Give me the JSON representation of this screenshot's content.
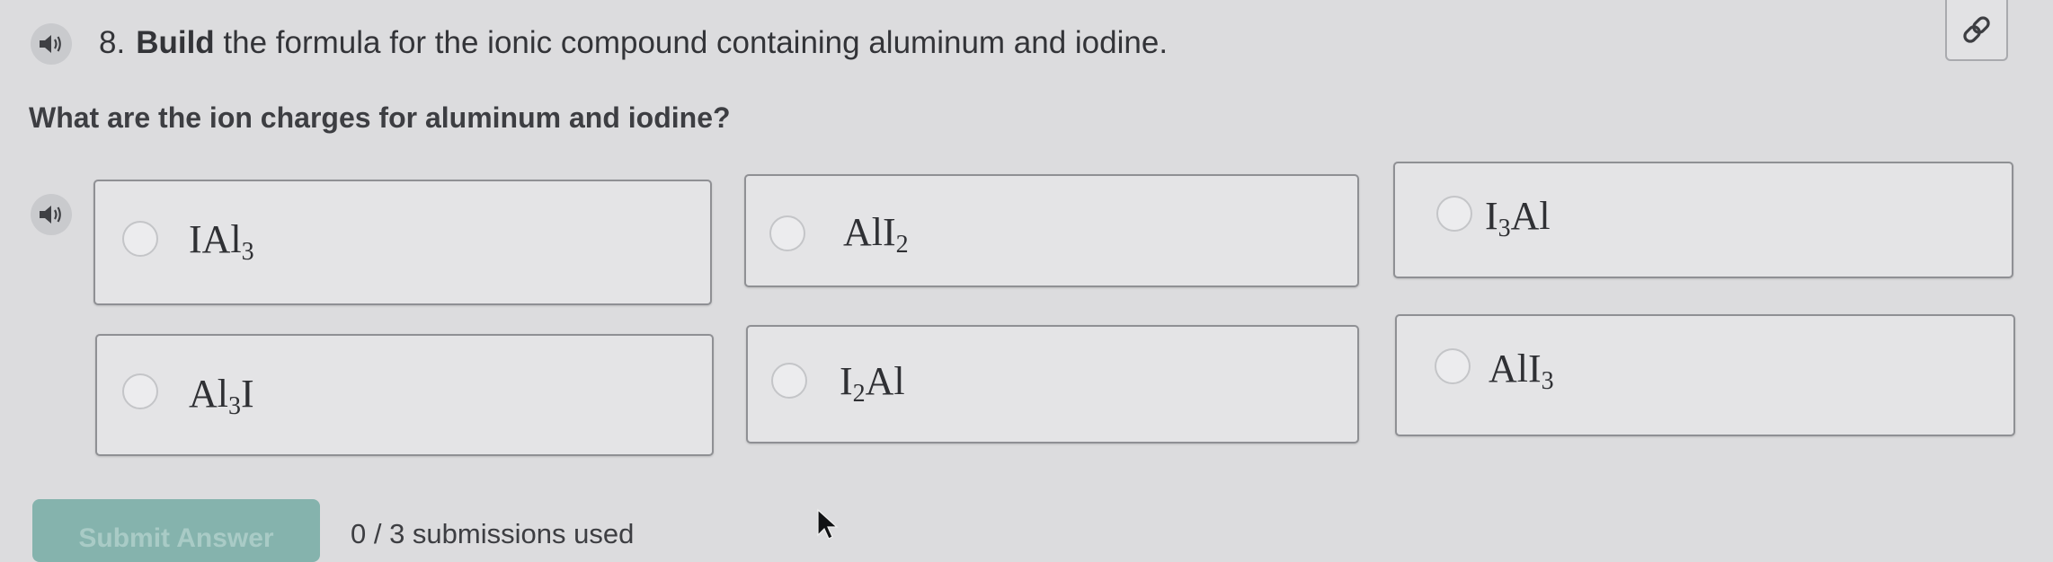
{
  "question": {
    "number": "8.",
    "verb": "Build",
    "text": " the formula for the ionic compound containing aluminum and iodine.",
    "speaker_icon": "speaker-icon"
  },
  "link_icon": "link-icon",
  "sub_question": "What are the ion charges for aluminum and iodine?",
  "choices_speaker_icon": "speaker-icon",
  "choices": [
    {
      "base1": "IAl",
      "sub1": "3",
      "base2": "",
      "sub2": ""
    },
    {
      "base1": "AlI",
      "sub1": "2",
      "base2": "",
      "sub2": ""
    },
    {
      "base1": "I",
      "sub1": "3",
      "base2": "Al",
      "sub2": ""
    },
    {
      "base1": "Al",
      "sub1": "3",
      "base2": "I",
      "sub2": ""
    },
    {
      "base1": "I",
      "sub1": "2",
      "base2": "Al",
      "sub2": ""
    },
    {
      "base1": "AlI",
      "sub1": "3",
      "base2": "",
      "sub2": ""
    }
  ],
  "submit": {
    "label": "Submit Answer"
  },
  "submissions_text": "0 / 3 submissions used",
  "colors": {
    "background": "#dcdcde",
    "submit_button": "#85b3ad",
    "choice_border": "#8f9094",
    "text": "#3b3c40"
  }
}
